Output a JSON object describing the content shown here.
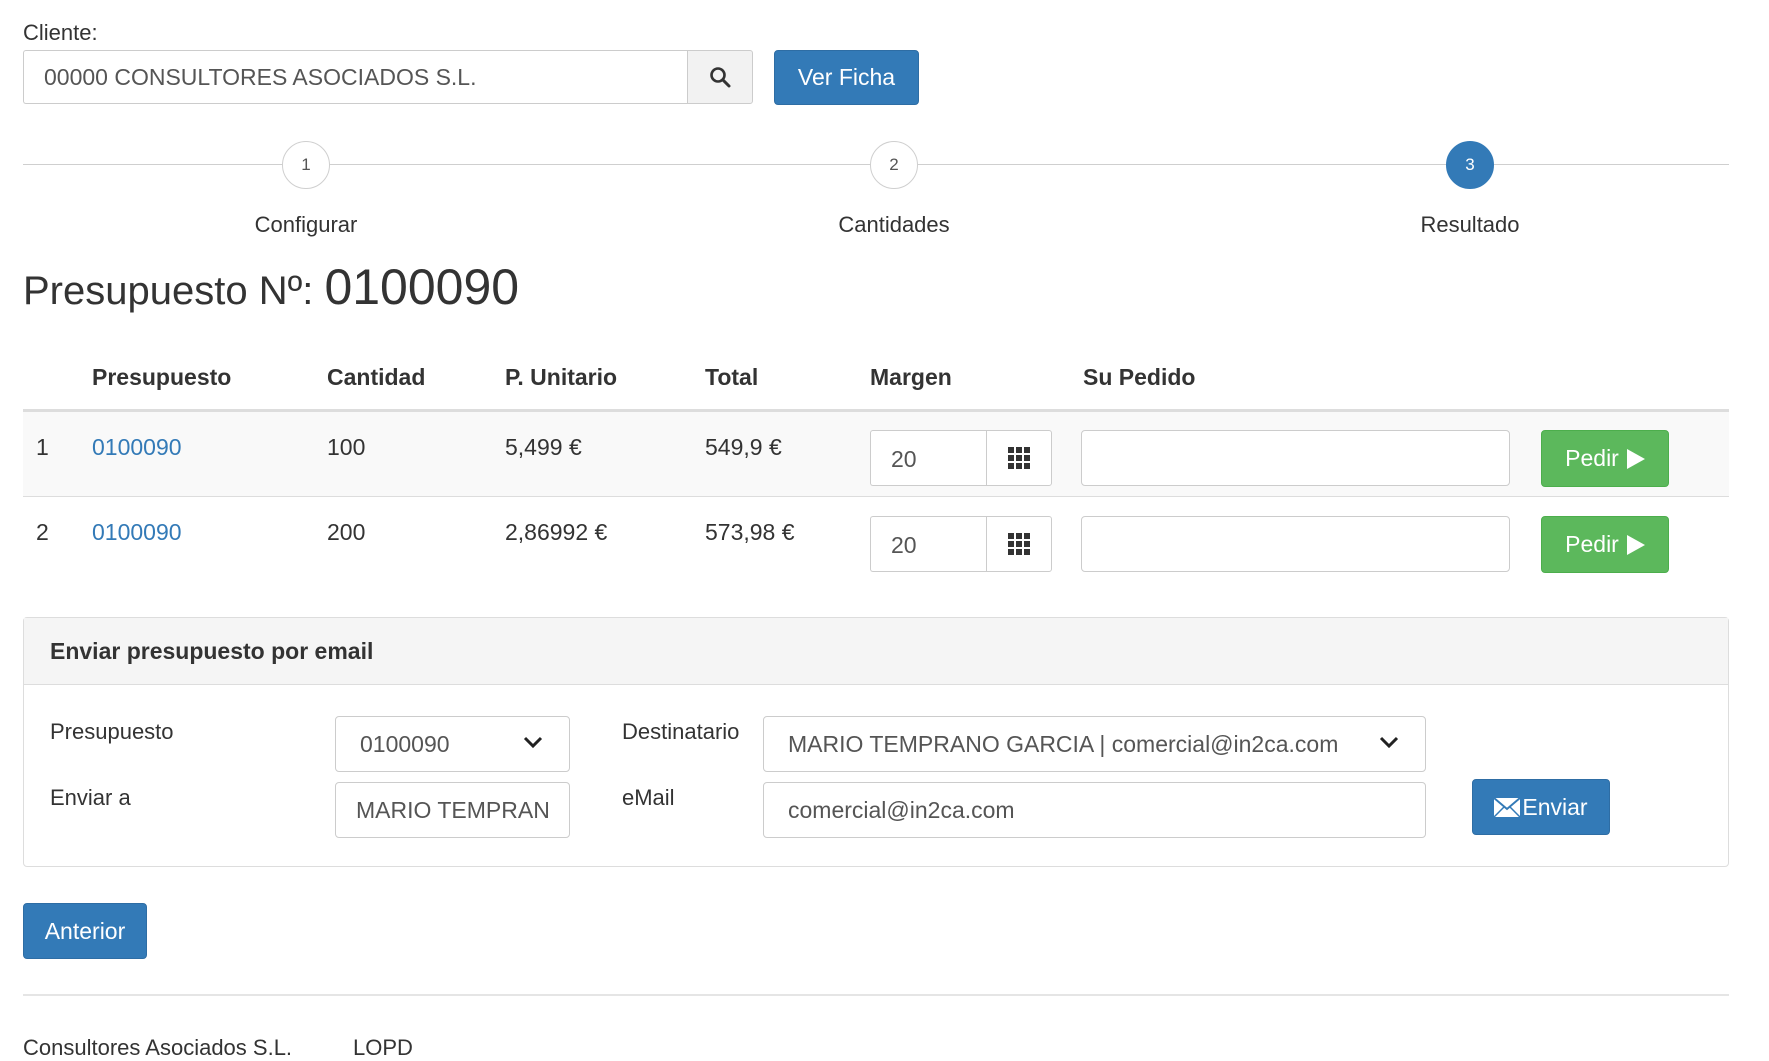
{
  "cliente": {
    "label": "Cliente:",
    "value": "00000 CONSULTORES ASOCIADOS S.L.",
    "search_icon": "search-icon",
    "ver_ficha_label": "Ver Ficha"
  },
  "wizard": {
    "steps": [
      {
        "number": "1",
        "label": "Configurar",
        "active": false
      },
      {
        "number": "2",
        "label": "Cantidades",
        "active": false
      },
      {
        "number": "3",
        "label": "Resultado",
        "active": true
      }
    ]
  },
  "presupuesto_title": {
    "label": "Presupuesto Nº:",
    "number": "0100090"
  },
  "table": {
    "headers": [
      "Presupuesto",
      "Cantidad",
      "P. Unitario",
      "Total",
      "Margen",
      "Su Pedido"
    ],
    "rows": [
      {
        "index": "1",
        "presupuesto": "0100090",
        "cantidad": "100",
        "unitario": "5,499 €",
        "total": "549,9 €",
        "margen": "20",
        "su_pedido": "",
        "action": "Pedir"
      },
      {
        "index": "2",
        "presupuesto": "0100090",
        "cantidad": "200",
        "unitario": "2,86992 €",
        "total": "573,98 €",
        "margen": "20",
        "su_pedido": "",
        "action": "Pedir"
      }
    ]
  },
  "email_panel": {
    "heading": "Enviar presupuesto por email",
    "presupuesto_label": "Presupuesto",
    "presupuesto_value": "0100090",
    "destinatario_label": "Destinatario",
    "destinatario_value": "MARIO TEMPRANO GARCIA | comercial@in2ca.com",
    "enviar_a_label": "Enviar a",
    "enviar_a_value": "MARIO TEMPRAN",
    "email_label": "eMail",
    "email_value": "comercial@in2ca.com",
    "enviar_button": "Enviar"
  },
  "anterior_button": "Anterior",
  "footer": {
    "company": "Consultores Asociados S.L.",
    "link": "LOPD"
  },
  "colors": {
    "primary": "#337ab7",
    "success": "#5cb85c",
    "link": "#337ab7"
  }
}
